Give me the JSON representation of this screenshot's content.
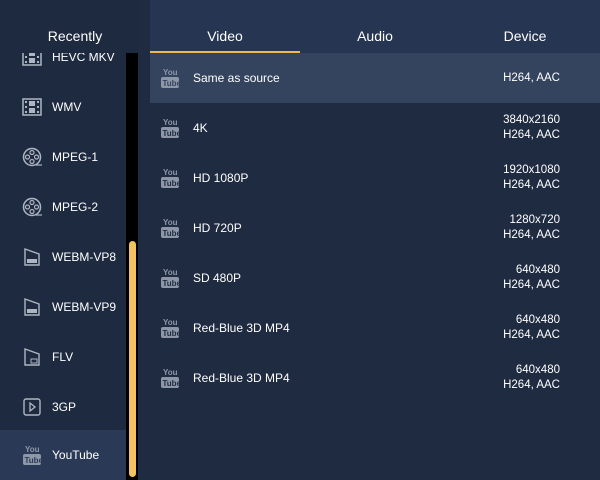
{
  "left_panel": {
    "header": "Recently",
    "items": [
      {
        "label": "HEVC MKV",
        "icon": "film-icon"
      },
      {
        "label": "WMV",
        "icon": "film-icon"
      },
      {
        "label": "MPEG-1",
        "icon": "reel-icon"
      },
      {
        "label": "MPEG-2",
        "icon": "reel-icon"
      },
      {
        "label": "WEBM-VP8",
        "icon": "webm-icon"
      },
      {
        "label": "WEBM-VP9",
        "icon": "webm-icon"
      },
      {
        "label": "FLV",
        "icon": "flv-icon"
      },
      {
        "label": "3GP",
        "icon": "play-icon"
      },
      {
        "label": "YouTube",
        "icon": "youtube-icon"
      }
    ],
    "selected": "YouTube"
  },
  "tabs": [
    {
      "label": "Video"
    },
    {
      "label": "Audio"
    },
    {
      "label": "Device"
    }
  ],
  "active_tab": "Video",
  "presets": [
    {
      "name": "Same as source",
      "resolution": "",
      "codec": "H264, AAC"
    },
    {
      "name": "4K",
      "resolution": "3840x2160",
      "codec": "H264, AAC"
    },
    {
      "name": "HD 1080P",
      "resolution": "1920x1080",
      "codec": "H264, AAC"
    },
    {
      "name": "HD 720P",
      "resolution": "1280x720",
      "codec": "H264, AAC"
    },
    {
      "name": "SD 480P",
      "resolution": "640x480",
      "codec": "H264, AAC"
    },
    {
      "name": "Red-Blue 3D MP4",
      "resolution": "640x480",
      "codec": "H264, AAC"
    },
    {
      "name": "Red-Blue 3D MP4",
      "resolution": "640x480",
      "codec": "H264, AAC"
    }
  ],
  "preset_icon": "youtube-icon",
  "colors": {
    "accent": "#f0b94d",
    "scroll_thumb": "#f2c35e",
    "background": "#1f2b41",
    "selected_row": "#34435e"
  }
}
